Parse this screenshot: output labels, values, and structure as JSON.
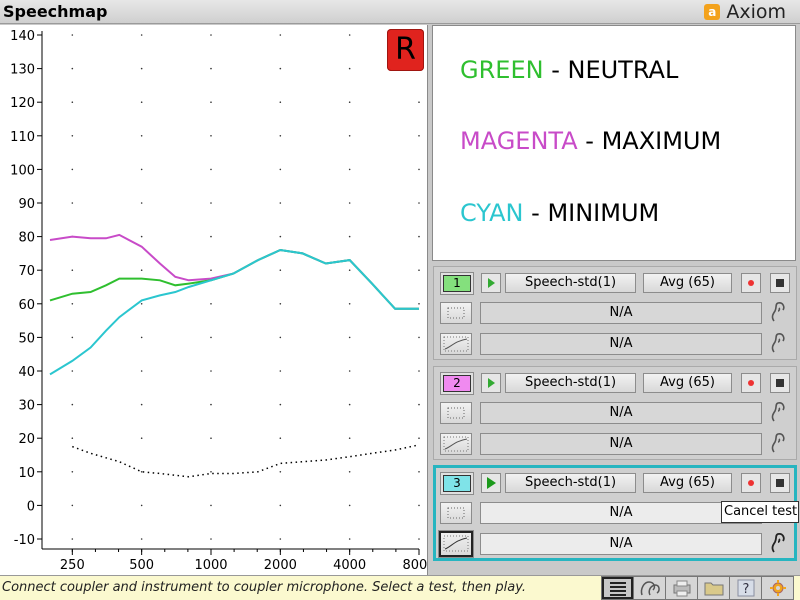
{
  "window": {
    "title": "Speechmap",
    "brand": "Axiom",
    "brand_logo_letter": "a"
  },
  "ear": "R",
  "legend": [
    {
      "color_word": "GREEN",
      "color": "#2fbf2f",
      "meaning": "NEUTRAL"
    },
    {
      "color_word": "MAGENTA",
      "color": "#c84bc8",
      "meaning": "MAXIMUM"
    },
    {
      "color_word": "CYAN",
      "color": "#2bc6cf",
      "meaning": "MINIMUM"
    }
  ],
  "tests": [
    {
      "number": "1",
      "color": "#84e07d",
      "signal": "Speech-std(1)",
      "level": "Avg (65)",
      "field1": "N/A",
      "field2": "N/A",
      "active": false
    },
    {
      "number": "2",
      "color": "#f08af0",
      "signal": "Speech-std(1)",
      "level": "Avg (65)",
      "field1": "N/A",
      "field2": "N/A",
      "active": false
    },
    {
      "number": "3",
      "color": "#7fe3e8",
      "signal": "Speech-std(1)",
      "level": "Avg (65)",
      "field1": "N/A",
      "field2": "N/A",
      "active": true
    }
  ],
  "tooltip": "Cancel test",
  "status_message": "Connect coupler and instrument to coupler microphone.  Select a test, then play.",
  "toolbar_icons": [
    "list-icon",
    "hearing-aid-icon",
    "printer-icon",
    "folder-icon",
    "help-icon",
    "settings-icon"
  ],
  "chart_data": {
    "type": "line",
    "x_scale": "log",
    "x_ticks": [
      "250",
      "500",
      "1000",
      "2000",
      "4000",
      "8000"
    ],
    "x_tick_values": [
      250,
      500,
      1000,
      2000,
      4000,
      8000
    ],
    "y_ticks": [
      140,
      130,
      120,
      110,
      100,
      90,
      80,
      70,
      60,
      50,
      40,
      30,
      20,
      10,
      0,
      -10
    ],
    "xlim": [
      200,
      8000
    ],
    "ylim": [
      -10,
      140
    ],
    "grid": "dots",
    "series": [
      {
        "color": "#c84bc8",
        "x": [
          200,
          250,
          300,
          350,
          400,
          500,
          600,
          700,
          800,
          1000,
          1250,
          1600,
          2000,
          2500,
          3150,
          4000,
          5000,
          6300,
          8000
        ],
        "y": [
          79,
          80,
          79.5,
          79.5,
          80.5,
          77,
          72,
          68,
          67,
          67.5,
          69,
          73,
          76,
          75,
          72,
          73,
          66,
          58.5,
          58.5
        ]
      },
      {
        "color": "#2fbf2f",
        "x": [
          200,
          250,
          300,
          350,
          400,
          500,
          600,
          700,
          800,
          1000,
          1250,
          1600,
          2000,
          2500,
          3150,
          4000,
          5000,
          6300,
          8000
        ],
        "y": [
          61,
          63,
          63.5,
          65.5,
          67.5,
          67.5,
          67,
          65.5,
          66,
          67,
          69,
          73,
          76,
          75,
          72,
          73,
          66,
          58.5,
          58.5
        ]
      },
      {
        "color": "#2bc6cf",
        "x": [
          200,
          250,
          300,
          350,
          400,
          500,
          600,
          700,
          800,
          1000,
          1250,
          1600,
          2000,
          2500,
          3150,
          4000,
          5000,
          6300,
          8000
        ],
        "y": [
          39,
          43,
          47,
          52,
          56,
          61,
          62.5,
          63.5,
          65,
          67,
          69,
          73,
          76,
          75,
          72,
          73,
          66,
          58.5,
          58.5
        ]
      },
      {
        "color": "#000000",
        "style": "dotted",
        "x": [
          250,
          300,
          400,
          500,
          600,
          800,
          1000,
          1250,
          1600,
          2000,
          2500,
          3150,
          4000,
          5000,
          6300,
          8000
        ],
        "y": [
          17.5,
          15.5,
          13,
          10,
          9.5,
          8.5,
          9.5,
          9.5,
          10,
          12.5,
          13,
          13.5,
          14.5,
          15.5,
          16.5,
          18
        ]
      }
    ]
  }
}
